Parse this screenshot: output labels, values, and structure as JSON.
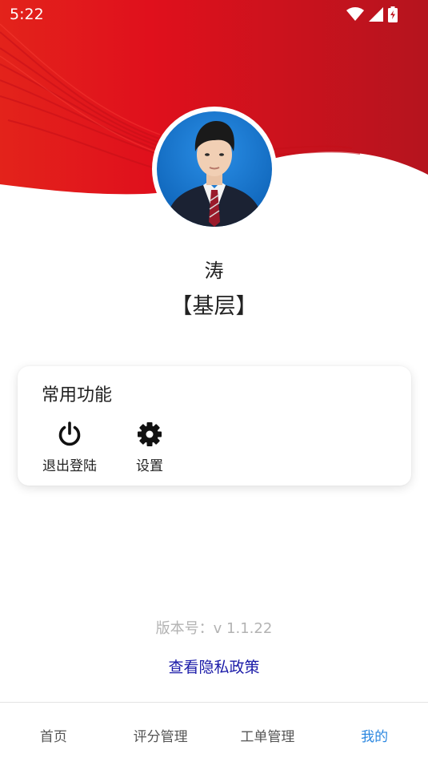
{
  "status_bar": {
    "time": "5:22",
    "icons": [
      "wifi-icon",
      "cellular-signal-icon",
      "battery-charging-icon"
    ]
  },
  "colors": {
    "header_red": "#e0101c",
    "header_dark_red": "#b5141e",
    "nav_active": "#2b87e0",
    "privacy_link": "#1a1aa8",
    "version_text": "#b3b3b3"
  },
  "profile": {
    "name": "涛",
    "role": "【基层】"
  },
  "functions": {
    "title": "常用功能",
    "items": [
      {
        "icon": "power-icon",
        "label": "退出登陆"
      },
      {
        "icon": "gear-icon",
        "label": "设置"
      }
    ]
  },
  "footer": {
    "version": "版本号：v 1.1.22",
    "privacy_link": "查看隐私政策"
  },
  "bottom_nav": {
    "items": [
      {
        "label": "首页",
        "active": false
      },
      {
        "label": "评分管理",
        "active": false
      },
      {
        "label": "工单管理",
        "active": false
      },
      {
        "label": "我的",
        "active": true
      }
    ]
  }
}
